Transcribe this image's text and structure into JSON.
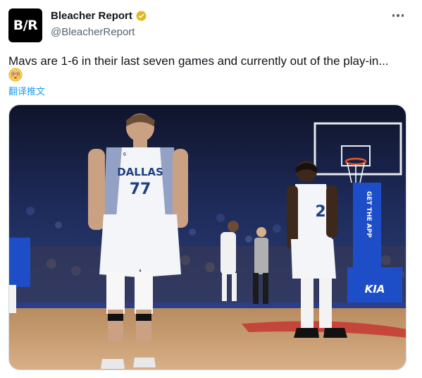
{
  "author": {
    "avatar_text": "B/R",
    "display_name": "Bleacher Report",
    "handle": "@BleacherReport",
    "verified": true,
    "verified_color": "#e2b719"
  },
  "tweet": {
    "text": "Mavs are 1-6 in their last seven games and currently out of the play-in...",
    "emoji": "flushed-face",
    "translate_label": "翻译推文"
  },
  "media": {
    "jersey_left_team": "DALLAS",
    "jersey_left_number": "77",
    "jersey_right_number": "2",
    "jersey_badge": "6",
    "stanchion_text": "GET THE APP",
    "sponsor_text": "KIA"
  },
  "colors": {
    "link": "#1d9bf0",
    "secondary": "#536471"
  }
}
